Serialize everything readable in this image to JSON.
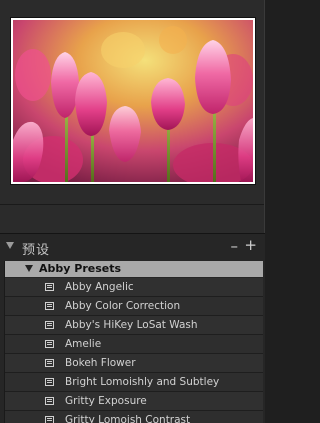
{
  "preview": {
    "image_alt": "Pink tulips"
  },
  "presets_panel": {
    "title": "预设",
    "collapse_icon": "triangle-down-icon",
    "remove_label": "–",
    "add_label": "+"
  },
  "folder": {
    "name": "Abby Presets",
    "expand_icon": "triangle-down-icon"
  },
  "presets": [
    {
      "label": "Abby Angelic",
      "icon": "preset-document-icon"
    },
    {
      "label": "Abby Color Correction",
      "icon": "preset-document-icon"
    },
    {
      "label": "Abby's HiKey LoSat Wash",
      "icon": "preset-document-icon"
    },
    {
      "label": "Amelie",
      "icon": "preset-document-icon"
    },
    {
      "label": "Bokeh Flower",
      "icon": "preset-document-icon"
    },
    {
      "label": "Bright Lomoishly and Subtley",
      "icon": "preset-document-icon"
    },
    {
      "label": "Gritty Exposure",
      "icon": "preset-document-icon"
    },
    {
      "label": "Gritty Lomoish Contrast",
      "icon": "preset-document-icon"
    }
  ]
}
